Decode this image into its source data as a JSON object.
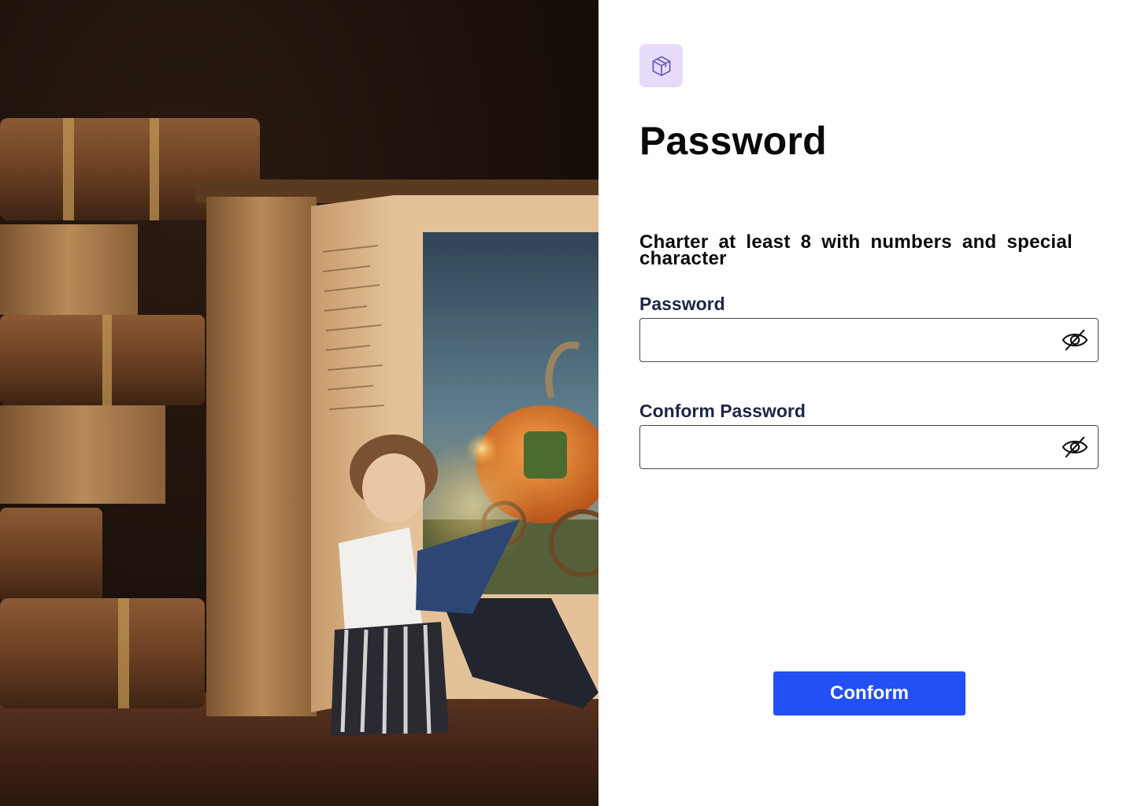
{
  "logo": {
    "icon": "cube-icon",
    "bg_color": "#e6dcfa",
    "icon_color": "#6d5fb0"
  },
  "title": "Password",
  "hint": "Charter at least 8 with numbers and special character",
  "fields": [
    {
      "label": "Password",
      "value": "",
      "placeholder": "",
      "toggle_icon": "eye-off-icon"
    },
    {
      "label": "Conform Password",
      "value": "",
      "placeholder": "",
      "toggle_icon": "eye-off-icon"
    }
  ],
  "submit": {
    "label": "Conform",
    "color": "#2250f4"
  },
  "hero": {
    "image": "girl-reading-in-giant-book-illustration"
  }
}
